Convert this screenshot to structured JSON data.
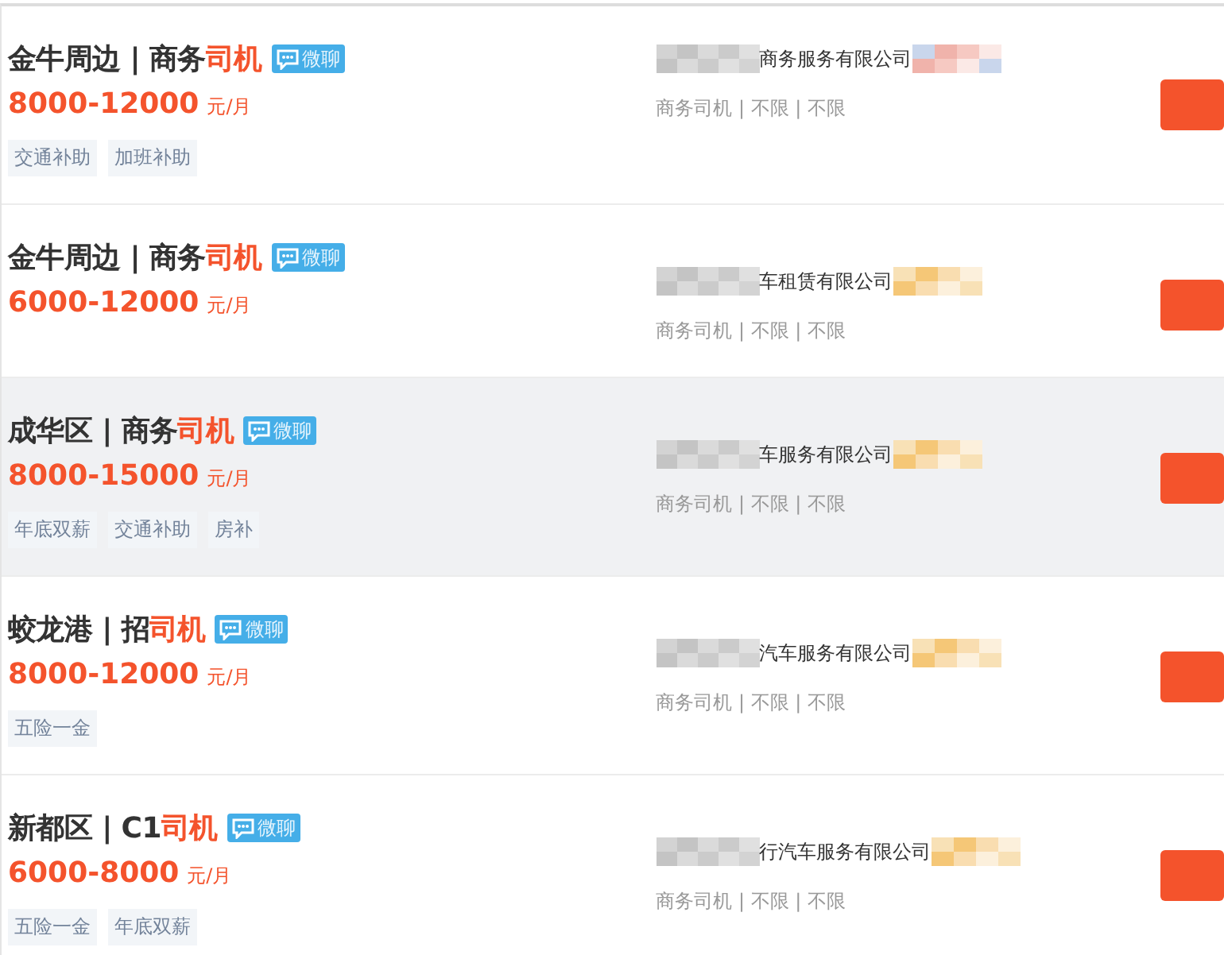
{
  "jobs": [
    {
      "title": "金牛周边 | 商务",
      "keyword": "司机",
      "chat_badge": "微聊",
      "salary": "8000-12000",
      "unit": "元/月",
      "tags": [
        "交通补助",
        "加班补助"
      ],
      "company": "商务服务有限公司",
      "meta": "商务司机 | 不限 | 不限",
      "highlighted": false
    },
    {
      "title": "金牛周边 | 商务",
      "keyword": "司机",
      "chat_badge": "微聊",
      "salary": "6000-12000",
      "unit": "元/月",
      "company": "车租赁有限公司",
      "meta": "商务司机 | 不限 | 不限",
      "highlighted": false
    },
    {
      "title": "成华区 | 商务",
      "keyword": "司机",
      "chat_badge": "微聊",
      "salary": "8000-15000",
      "unit": "元/月",
      "tags": [
        "年底双薪",
        "交通补助",
        "房补"
      ],
      "company": "车服务有限公司",
      "meta": "商务司机 | 不限 | 不限",
      "highlighted": true
    },
    {
      "title": "蛟龙港 | 招",
      "keyword": "司机",
      "chat_badge": "微聊",
      "salary": "8000-12000",
      "unit": "元/月",
      "tags": [
        "五险一金"
      ],
      "company": "汽车服务有限公司",
      "meta": "商务司机 | 不限 | 不限",
      "highlighted": false
    },
    {
      "title": "新都区 | C1",
      "keyword": "司机",
      "chat_badge": "微聊",
      "salary": "6000-8000",
      "unit": "元/月",
      "tags": [
        "五险一金",
        "年底双薪"
      ],
      "company": "行汽车服务有限公司",
      "meta": "商务司机 | 不限 | 不限",
      "highlighted": false
    }
  ]
}
